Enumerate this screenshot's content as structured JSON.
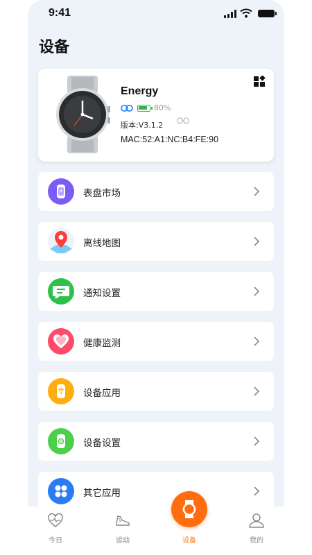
{
  "status": {
    "time": "9:41"
  },
  "page": {
    "title": "设备"
  },
  "device": {
    "name": "Energy",
    "battery": "80%",
    "version": "版本:V3.1.2",
    "mac": "MAC:52:A1:NC:B4:FE:90"
  },
  "menu": [
    {
      "label": "表盘市场",
      "icon": "watch-face-icon",
      "color": "#7b5cf5"
    },
    {
      "label": "离线地图",
      "icon": "map-pin-icon",
      "color": "#ff3b3b"
    },
    {
      "label": "通知设置",
      "icon": "message-icon",
      "color": "#2bc24b"
    },
    {
      "label": "健康监测",
      "icon": "heart-icon",
      "color": "#ff4a6a"
    },
    {
      "label": "设备应用",
      "icon": "watch-wifi-icon",
      "color": "#ffae12"
    },
    {
      "label": "设备设置",
      "icon": "watch-settings-icon",
      "color": "#4cd04a"
    },
    {
      "label": "其它应用",
      "icon": "apps-icon",
      "color": "#2a7cf6"
    }
  ],
  "tabs": [
    {
      "label": "今日",
      "icon": "heart-pulse-icon"
    },
    {
      "label": "运动",
      "icon": "shoe-icon"
    },
    {
      "label": "设备",
      "icon": "watch-icon",
      "active": true
    },
    {
      "label": "我的",
      "icon": "person-icon"
    }
  ],
  "colors": {
    "accent": "#ff6d10",
    "background": "#eef3f9"
  }
}
